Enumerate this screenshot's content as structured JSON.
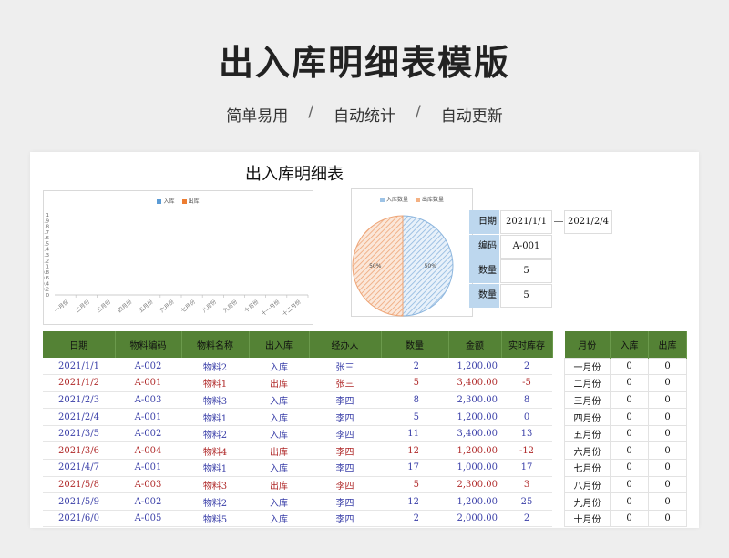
{
  "header": {
    "title": "出入库明细表模版",
    "subtitle": [
      "简单易用",
      "自动统计",
      "自动更新"
    ],
    "separator": "/"
  },
  "sheet": {
    "title": "出入库明细表"
  },
  "bar_chart": {
    "legend": [
      {
        "name": "入库",
        "color": "#5b9bd5"
      },
      {
        "name": "出库",
        "color": "#ed7d31"
      }
    ],
    "yticks": [
      "1",
      "1.9",
      "1.8",
      "1.7",
      "1.6",
      "1.5",
      "1.4",
      "1.3",
      "1.2",
      "1",
      "0.8",
      "0.6",
      "0.4",
      "0.2",
      "0"
    ],
    "months": [
      "一月份",
      "二月份",
      "三月份",
      "四月份",
      "五月份",
      "六月份",
      "七月份",
      "八月份",
      "九月份",
      "十月份",
      "十一月份",
      "十二月份"
    ]
  },
  "pie_chart": {
    "legend": [
      {
        "name": "入库数量",
        "color": "#9dc3e6"
      },
      {
        "name": "出库数量",
        "color": "#f4b183"
      }
    ],
    "labels": [
      "50%",
      "50%"
    ],
    "values": [
      50,
      50
    ]
  },
  "chart_data": [
    {
      "type": "bar",
      "categories": [
        "一月份",
        "二月份",
        "三月份",
        "四月份",
        "五月份",
        "六月份",
        "七月份",
        "八月份",
        "九月份",
        "十月份",
        "十一月份",
        "十二月份"
      ],
      "series": [
        {
          "name": "入库",
          "values": [
            0,
            0,
            0,
            0,
            0,
            0,
            0,
            0,
            0,
            0,
            0,
            0
          ]
        },
        {
          "name": "出库",
          "values": [
            0,
            0,
            0,
            0,
            0,
            0,
            0,
            0,
            0,
            0,
            0,
            0
          ]
        }
      ],
      "ylim": [
        0,
        1
      ]
    },
    {
      "type": "pie",
      "categories": [
        "入库数量",
        "出库数量"
      ],
      "values": [
        50,
        50
      ]
    }
  ],
  "summary": {
    "rows": [
      {
        "label": "日期",
        "value": "2021/1/1",
        "value2": "2021/2/4"
      },
      {
        "label": "编码",
        "value": "A-001"
      },
      {
        "label": "数量",
        "value": "5"
      },
      {
        "label": "数量",
        "value": "5"
      }
    ]
  },
  "table": {
    "headers": [
      "日期",
      "物料编码",
      "物料名称",
      "出入库",
      "经办人",
      "数量",
      "金额",
      "实时库存"
    ],
    "rows": [
      [
        "2021/1/1",
        "A-002",
        "物料2",
        "入库",
        "张三",
        "2",
        "1,200.00",
        "2"
      ],
      [
        "2021/1/2",
        "A-001",
        "物料1",
        "出库",
        "张三",
        "5",
        "3,400.00",
        "-5"
      ],
      [
        "2021/2/3",
        "A-003",
        "物料3",
        "入库",
        "李四",
        "8",
        "2,300.00",
        "8"
      ],
      [
        "2021/2/4",
        "A-001",
        "物料1",
        "入库",
        "李四",
        "5",
        "1,200.00",
        "0"
      ],
      [
        "2021/3/5",
        "A-002",
        "物料2",
        "入库",
        "李四",
        "11",
        "3,400.00",
        "13"
      ],
      [
        "2021/3/6",
        "A-004",
        "物料4",
        "出库",
        "李四",
        "12",
        "1,200.00",
        "-12"
      ],
      [
        "2021/4/7",
        "A-001",
        "物料1",
        "入库",
        "李四",
        "17",
        "1,000.00",
        "17"
      ],
      [
        "2021/5/8",
        "A-003",
        "物料3",
        "出库",
        "李四",
        "5",
        "2,300.00",
        "3"
      ],
      [
        "2021/5/9",
        "A-002",
        "物料2",
        "入库",
        "李四",
        "12",
        "1,200.00",
        "25"
      ],
      [
        "2021/6/0",
        "A-005",
        "物料5",
        "入库",
        "李四",
        "2",
        "2,000.00",
        "2"
      ]
    ]
  },
  "month_table": {
    "headers": [
      "月份",
      "入库",
      "出库"
    ],
    "rows": [
      [
        "一月份",
        "0",
        "0"
      ],
      [
        "二月份",
        "0",
        "0"
      ],
      [
        "三月份",
        "0",
        "0"
      ],
      [
        "四月份",
        "0",
        "0"
      ],
      [
        "五月份",
        "0",
        "0"
      ],
      [
        "六月份",
        "0",
        "0"
      ],
      [
        "七月份",
        "0",
        "0"
      ],
      [
        "八月份",
        "0",
        "0"
      ],
      [
        "九月份",
        "0",
        "0"
      ],
      [
        "十月份",
        "0",
        "0"
      ]
    ]
  }
}
